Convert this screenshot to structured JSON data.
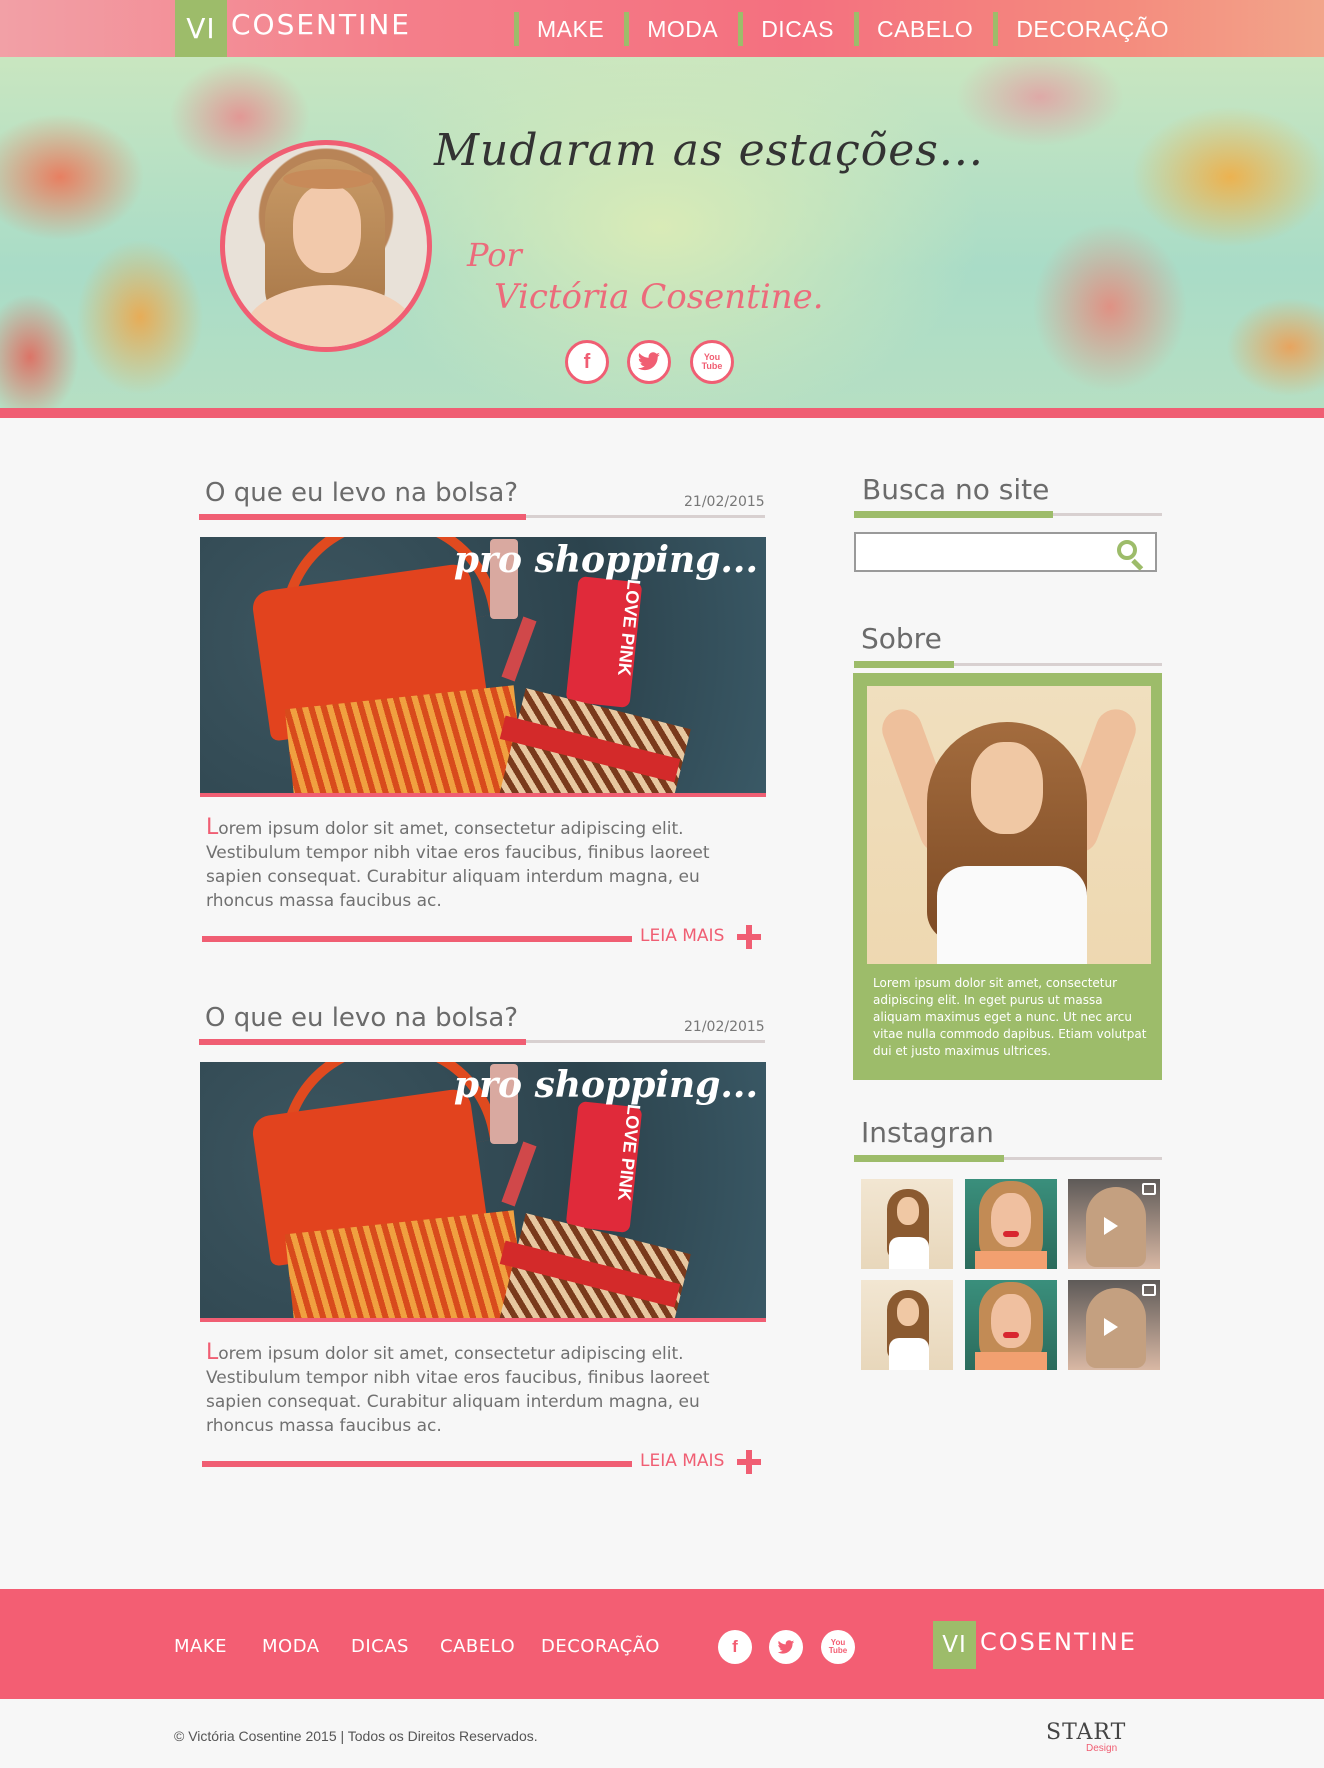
{
  "brand": {
    "vi": "VI",
    "name": "COSENTINE"
  },
  "nav": [
    "MAKE",
    "MODA",
    "DICAS",
    "CABELO",
    "DECORAÇÃO"
  ],
  "hero": {
    "title": "Mudaram as estações...",
    "por": "Por",
    "author": "Victória Cosentine.",
    "social": {
      "facebook": "f",
      "twitter": "t",
      "youtube_top": "You",
      "youtube_bottom": "Tube"
    }
  },
  "posts": [
    {
      "title": "O que eu levo na bolsa?",
      "date": "21/02/2015",
      "image_caption": "pro shopping...",
      "phone_text": "LOVE PINK",
      "first_letter": "L",
      "body": "orem ipsum dolor sit amet, consectetur adipiscing elit. Vestibulum tempor nibh vitae eros faucibus, finibus laoreet sapien consequat. Curabitur aliquam interdum magna, eu rhoncus massa faucibus ac.",
      "read_more": "LEIA MAIS"
    },
    {
      "title": "O que eu levo na bolsa?",
      "date": "21/02/2015",
      "image_caption": "pro shopping...",
      "phone_text": "LOVE PINK",
      "first_letter": "L",
      "body": "orem ipsum dolor sit amet, consectetur adipiscing elit. Vestibulum tempor nibh vitae eros faucibus, finibus laoreet sapien consequat. Curabitur aliquam interdum magna, eu rhoncus massa faucibus ac.",
      "read_more": "LEIA MAIS"
    }
  ],
  "sidebar": {
    "search_title": "Busca no site",
    "search_placeholder": "",
    "about_title": "Sobre",
    "about_text": "Lorem ipsum dolor sit amet, consectetur adipiscing elit. In eget purus ut massa aliquam maximus eget a nunc. Ut nec arcu vitae nulla commodo dapibus. Etiam volutpat dui et justo maximus ultrices.",
    "instagram_title": "Instagran"
  },
  "footer": {
    "nav": [
      "MAKE",
      "MODA",
      "DICAS",
      "CABELO",
      "DECORAÇÃO"
    ],
    "copyright": "© Victória Cosentine 2015 | Todos os Direitos Reservados.",
    "credit_main": "START",
    "credit_sub": "Design"
  },
  "colors": {
    "pink": "#f05e73",
    "green": "#9dbc6a",
    "text": "#6b6b6b"
  }
}
